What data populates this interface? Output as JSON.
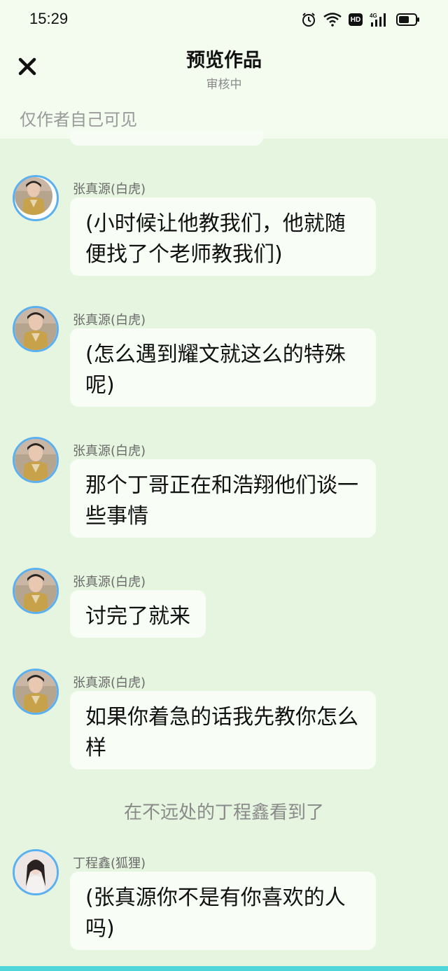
{
  "status_bar": {
    "time": "15:29",
    "icons": [
      "alarm-icon",
      "wifi-icon",
      "hd-icon",
      "signal-4g-icon",
      "battery-icon"
    ],
    "hd_label": "HD",
    "net_label": "4G"
  },
  "header": {
    "title": "预览作品",
    "subtitle": "审核中",
    "close_icon": "close-icon"
  },
  "visibility_note": "仅作者自己可见",
  "colors": {
    "background": "#e6f5e0",
    "header_background": "#f3fcef",
    "bubble": "#f8fdf6",
    "avatar_ring": "#5ab0f0",
    "bottom_strip": "#4fd6d8"
  },
  "messages": [
    {
      "sender": "张真源(白虎)",
      "text_lines": [
        "(小时候让他教我们，他就随",
        "便找了个老师教我们)"
      ]
    },
    {
      "sender": "张真源(白虎)",
      "text_lines": [
        "(怎么遇到耀文就这么的特殊",
        "呢)"
      ]
    },
    {
      "sender": "张真源(白虎)",
      "text_lines": [
        "那个丁哥正在和浩翔他们谈一",
        "些事情"
      ]
    },
    {
      "sender": "张真源(白虎)",
      "text_lines": [
        "讨完了就来"
      ]
    },
    {
      "sender": "张真源(白虎)",
      "text_lines": [
        "如果你着急的话我先教你怎么",
        "样"
      ]
    },
    {
      "sender": "丁程鑫(狐狸)",
      "text_lines": [
        "(张真源你不是有你喜欢的人",
        "吗)"
      ]
    }
  ],
  "narration": "在不远处的丁程鑫看到了"
}
